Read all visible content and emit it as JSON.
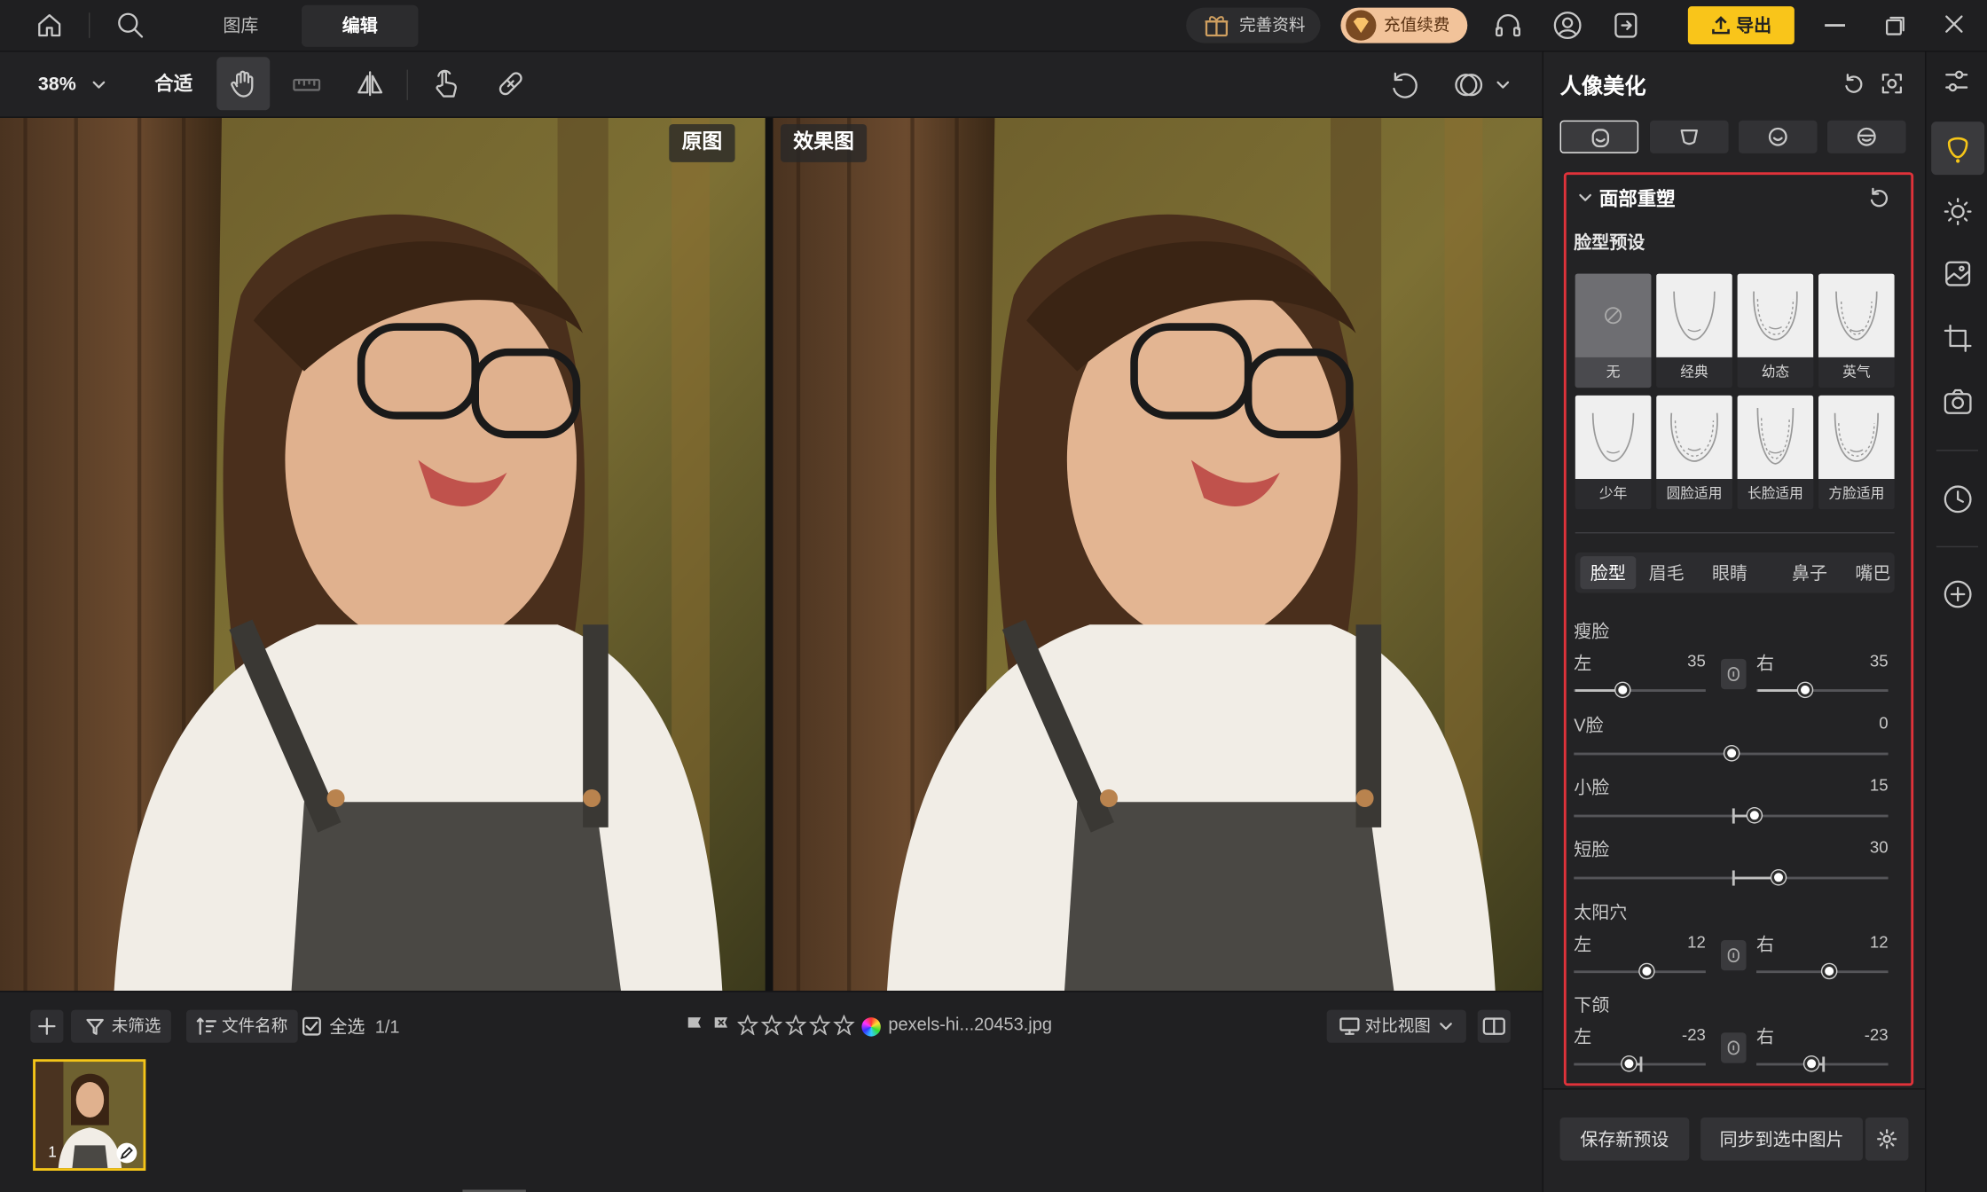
{
  "nav": {
    "tabs": [
      "图库",
      "编辑"
    ],
    "active": "编辑"
  },
  "topbar": {
    "complete_profile": "完善资料",
    "recharge": "充值续费",
    "export": "导出"
  },
  "toolbar": {
    "zoom": "38%",
    "fit": "合适"
  },
  "canvas": {
    "original_label": "原图",
    "effect_label": "效果图"
  },
  "bottom": {
    "filter": "未筛选",
    "sort": "文件名称",
    "select_all": "全选",
    "count": "1/1",
    "filename": "pexels-hi...20453.jpg",
    "view_mode": "对比视图",
    "thumb_index": "1"
  },
  "panel": {
    "title": "人像美化",
    "section": "面部重塑",
    "preset_title": "脸型预设",
    "presets": [
      "无",
      "经典",
      "幼态",
      "英气",
      "少年",
      "圆脸适用",
      "长脸适用",
      "方脸适用"
    ],
    "feature_tabs": [
      "脸型",
      "眉毛",
      "眼睛",
      "鼻子",
      "嘴巴"
    ],
    "active_feature": "脸型",
    "sliders": {
      "thin_face": {
        "label": "瘦脸",
        "left": "左",
        "right": "右",
        "left_value": "35",
        "right_value": "35"
      },
      "v_face": {
        "label": "V脸",
        "value": "0"
      },
      "small_face": {
        "label": "小脸",
        "value": "15"
      },
      "short_face": {
        "label": "短脸",
        "value": "30"
      },
      "temple": {
        "label": "太阳穴",
        "left": "左",
        "right": "右",
        "left_value": "12",
        "right_value": "12"
      },
      "jaw": {
        "label": "下颌",
        "left": "左",
        "right": "右",
        "left_value": "-23",
        "right_value": "-23"
      }
    },
    "save_preset": "保存新预设",
    "sync": "同步到选中图片"
  },
  "colors": {
    "accent": "#f5c518",
    "highlight_border": "#e0323a",
    "recharge_bg": "#f4c9a0",
    "export_bg": "#f9c51a"
  }
}
